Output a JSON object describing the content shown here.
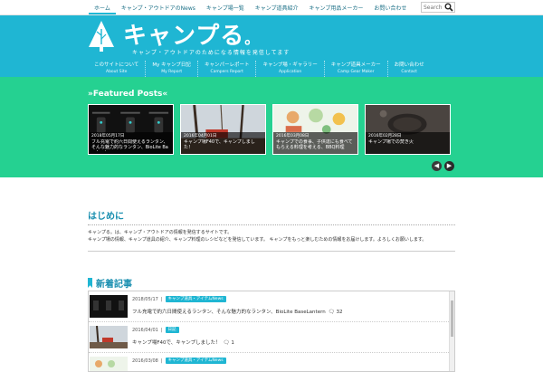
{
  "topnav": {
    "items": [
      {
        "label": "ホーム"
      },
      {
        "label": "キャンプ・アウトドアのNews"
      },
      {
        "label": "キャンプ場一覧"
      },
      {
        "label": "キャンプ道具紹介"
      },
      {
        "label": "キャンプ用品メーカー"
      },
      {
        "label": "お問い合わせ"
      }
    ]
  },
  "search": {
    "placeholder": "Search"
  },
  "logo": {
    "title": "キャンプる",
    "suffix": "。",
    "tagline": "キャンプ・アウトドアのためになる情報を発信してます"
  },
  "mainnav": {
    "items": [
      {
        "jp": "このサイトについて",
        "en": "About Site"
      },
      {
        "jp": "My キャンプ日記",
        "en": "My Report"
      },
      {
        "jp": "キャンパーレポート",
        "en": "Campers Report"
      },
      {
        "jp": "キャンプ場・ギャラリー",
        "en": "Application"
      },
      {
        "jp": "キャンプ道具メーカー",
        "en": "Camp Gear Maker"
      },
      {
        "jp": "お問い合わせ",
        "en": "Contact"
      }
    ]
  },
  "featured": {
    "title": "»Featured Posts«",
    "cards": [
      {
        "date": "2018年05月17日",
        "title": "フル充電で約六日間使えるランタン、そんな魅力的なランタン、BioLite BaseLantern"
      },
      {
        "date": "2016年04月01日",
        "title": "キャンプ場F40で、キャンプしました！"
      },
      {
        "date": "2016年03月08日",
        "title": "キャンプでの食事、子供達にも食べてもらえる料理を考える、BBQ料理"
      },
      {
        "date": "2016年02月28日",
        "title": "キャンプ場での焚き火"
      }
    ]
  },
  "about": {
    "heading": "はじめに",
    "line1": "キャンプる。は、キャンプ・アウトドアの情報を発信するサイトです。",
    "line2": "キャンプ場の情報、キャンプ道具の紹介、キャンプ料理のレシピなどを発信しています。 キャンプをもっと楽しむための情報をお届けします。よろしくお願いします。"
  },
  "newest": {
    "heading": "新着記事",
    "rows": [
      {
        "date": "2018/05/17",
        "sep": "|",
        "tag": "キャンプ道具・アイテムNews",
        "title": "フル充電で約六日間使えるランタン、そんな魅力的なランタン、BioLite BaseLantern",
        "comments": "32"
      },
      {
        "date": "2016/04/01",
        "sep": "|",
        "tag": "日記",
        "title": "キャンプ場F40で、キャンプしました！",
        "comments": "1"
      },
      {
        "date": "2016/03/08",
        "sep": "|",
        "tag": "キャンプ道具・アイテムNews",
        "title": "",
        "comments": ""
      }
    ]
  },
  "colors": {
    "header": "#1fb6d3",
    "featured": "#25d191",
    "accent": "#1a8fb0"
  }
}
